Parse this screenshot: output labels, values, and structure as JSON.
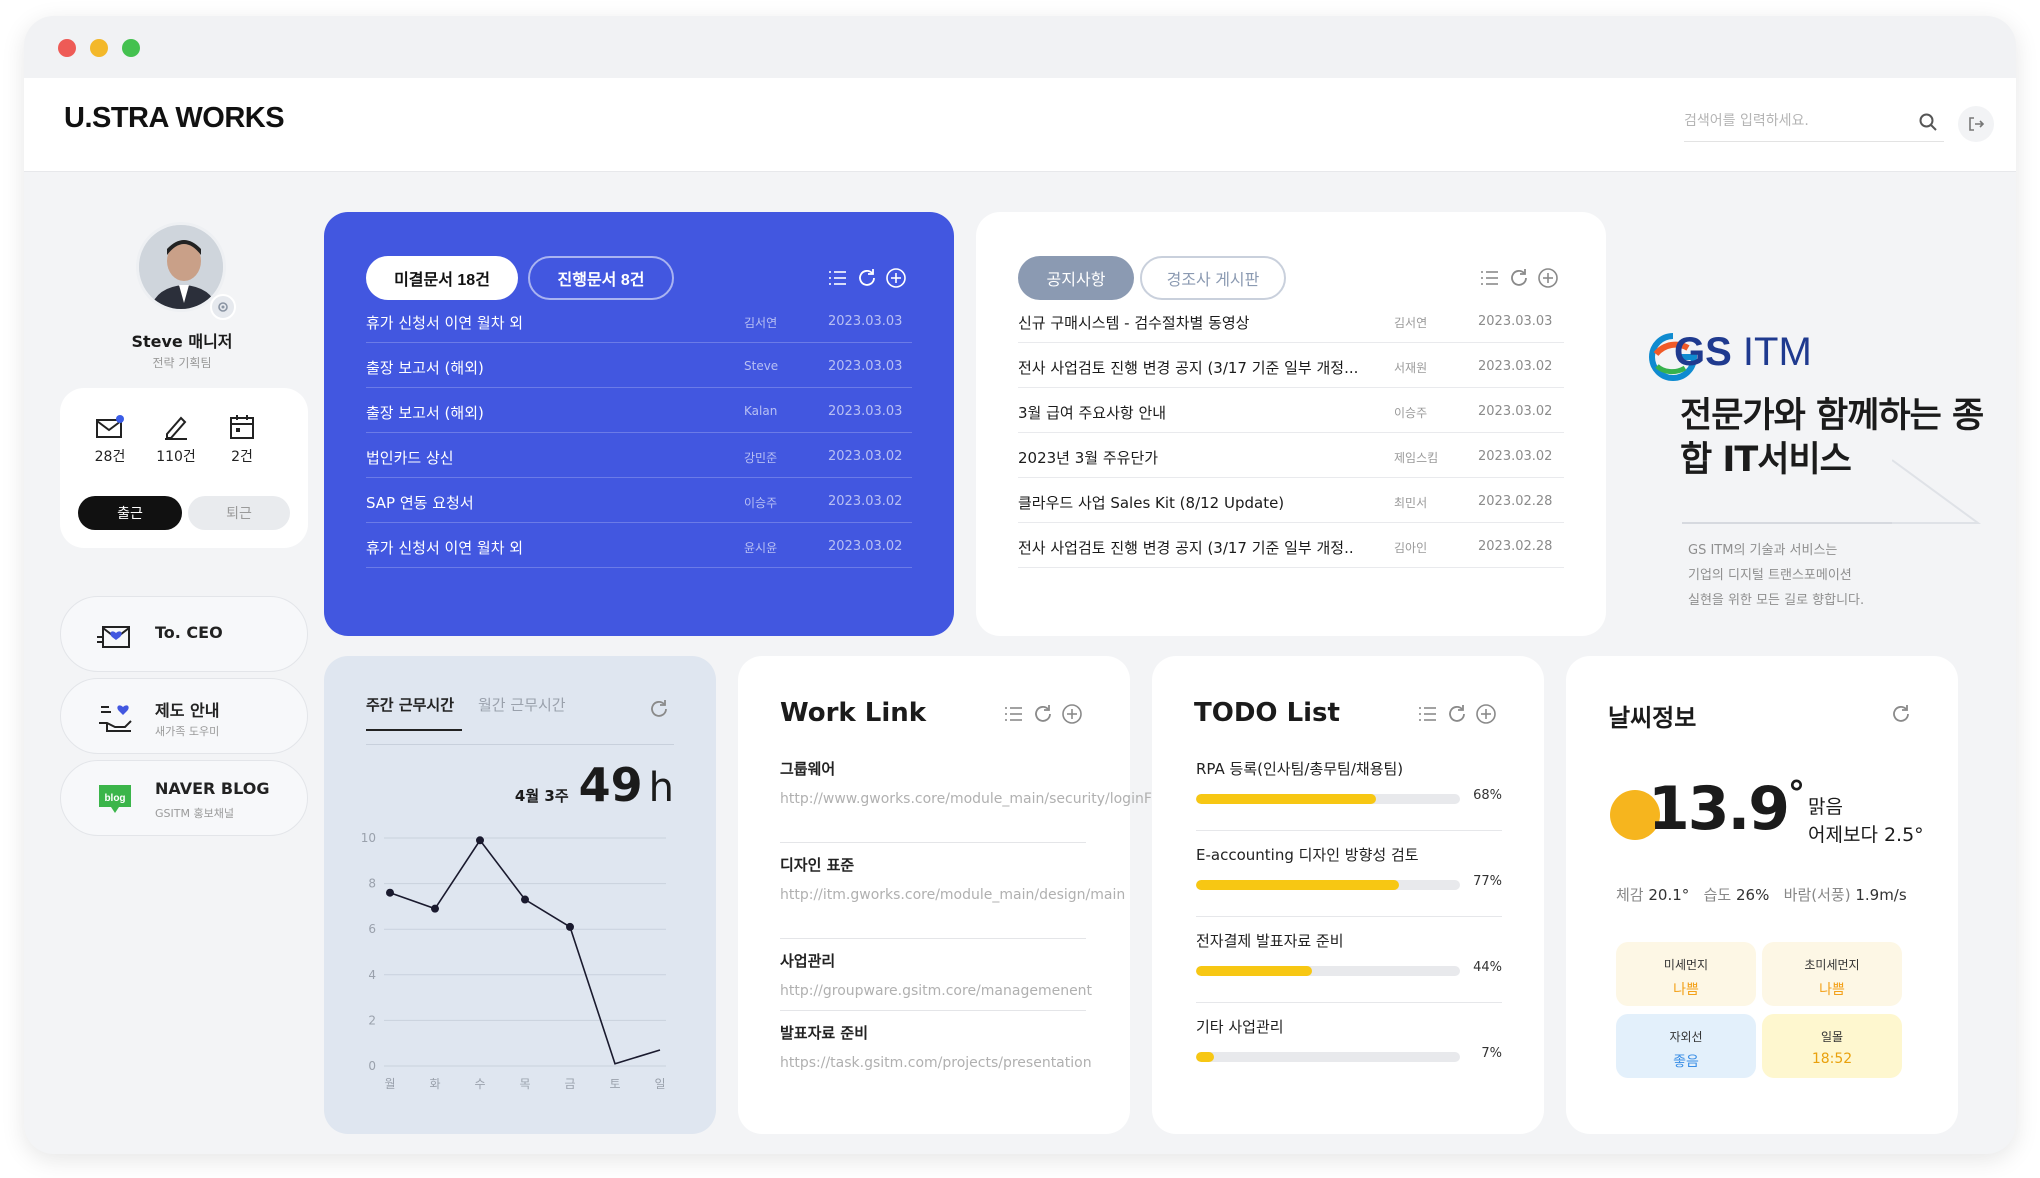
{
  "brand": {
    "logo": "U.STRA WORKS"
  },
  "header": {
    "search_placeholder": "검색어를 입력하세요."
  },
  "user": {
    "name": "Steve 매니저",
    "dept": "전략 기획팀",
    "stats": [
      {
        "icon": "mail-icon",
        "count": "28건"
      },
      {
        "icon": "pen-icon",
        "count": "110건"
      },
      {
        "icon": "calendar-icon",
        "count": "2건"
      }
    ],
    "checkin_label": "출근",
    "checkout_label": "퇴근"
  },
  "side_links": [
    {
      "title": "To. CEO",
      "sub": "",
      "icon": "heart-mail-icon"
    },
    {
      "title": "제도 안내",
      "sub": "새가족 도우미",
      "icon": "hand-heart-icon"
    },
    {
      "title": "NAVER BLOG",
      "sub": "GSITM 홍보채널",
      "icon": "blog-icon"
    }
  ],
  "approval": {
    "tabs": [
      "미결문서 18건",
      "진행문서 8건"
    ],
    "rows": [
      {
        "title": "휴가 신청서 이연 월차 외",
        "author": "김서연",
        "date": "2023.03.03"
      },
      {
        "title": "출장 보고서 (해외)",
        "author": "Steve",
        "date": "2023.03.03"
      },
      {
        "title": "출장 보고서 (해외)",
        "author": "Kalan",
        "date": "2023.03.03"
      },
      {
        "title": "법인카드 상신",
        "author": "강민준",
        "date": "2023.03.02"
      },
      {
        "title": "SAP 연동 요청서",
        "author": "이승주",
        "date": "2023.03.02"
      },
      {
        "title": "휴가 신청서 이연 월차 외",
        "author": "윤시윤",
        "date": "2023.03.02"
      }
    ]
  },
  "notice": {
    "tabs": [
      "공지사항",
      "경조사 게시판"
    ],
    "rows": [
      {
        "title": "신규 구매시스템 - 검수절차별 동영상",
        "author": "김서연",
        "date": "2023.03.03"
      },
      {
        "title": "전사 사업검토 진행 변경 공지 (3/17 기준 일부 개정...",
        "author": "서재원",
        "date": "2023.03.02"
      },
      {
        "title": "3월 급여 주요사항 안내",
        "author": "이승주",
        "date": "2023.03.02"
      },
      {
        "title": "2023년 3월 주유단가",
        "author": "제임스킴",
        "date": "2023.03.02"
      },
      {
        "title": "클라우드 사업 Sales Kit (8/12 Update)",
        "author": "최민서",
        "date": "2023.02.28"
      },
      {
        "title": "전사 사업검토 진행 변경 공지 (3/17 기준 일부 개정..",
        "author": "김아인",
        "date": "2023.02.28"
      }
    ]
  },
  "ad": {
    "logo_gs": "GS",
    "logo_itm": "ITM",
    "headline": "전문가와 함께하는 종합 IT서비스",
    "text_lines": [
      "GS ITM의 기술과 서비스는",
      "기업의 디지털 트랜스포메이션",
      "실현을 위한 모든 길로 향합니다."
    ]
  },
  "worktime": {
    "tabs": [
      "주간 근무시간",
      "월간 근무시간"
    ],
    "week_label": "4월 3주",
    "hours": "49",
    "unit": "h"
  },
  "chart_data": {
    "type": "line",
    "categories": [
      "월",
      "화",
      "수",
      "목",
      "금",
      "토",
      "일"
    ],
    "values": [
      7.6,
      6.9,
      9.9,
      7.3,
      6.1,
      0.1,
      0.7
    ],
    "ylim": [
      0,
      10
    ],
    "yticks": [
      "0",
      "2",
      "4",
      "6",
      "8",
      "10"
    ],
    "grid": true
  },
  "worklink": {
    "title": "Work Link",
    "items": [
      {
        "title": "그룹웨어",
        "url": "http://www.gworks.core/module_main/security/loginForm"
      },
      {
        "title": "디자인 표준",
        "url": "http://itm.gworks.core/module_main/design/main"
      },
      {
        "title": "사업관리",
        "url": "http://groupware.gsitm.core/managemenent"
      },
      {
        "title": "발표자료 준비",
        "url": "https://task.gsitm.com/projects/presentation"
      }
    ]
  },
  "todo": {
    "title": "TODO List",
    "items": [
      {
        "title": "RPA 등록(인사팀/총무팀/채용팀)",
        "percent": 68,
        "label": "68%"
      },
      {
        "title": "E-accounting 디자인 방향성 검토",
        "percent": 77,
        "label": "77%"
      },
      {
        "title": "전자결제 발표자료 준비",
        "percent": 44,
        "label": "44%"
      },
      {
        "title": "기타 사업관리",
        "percent": 7,
        "label": "7%"
      }
    ]
  },
  "weather": {
    "title": "날씨정보",
    "temp": "13.9",
    "deg": "°",
    "condition": "맑음",
    "compare": "어제보다 2.5°",
    "feels_label": "체감",
    "feels": "20.1°",
    "humidity_label": "습도",
    "humidity": "26%",
    "wind_label": "바람(서풍)",
    "wind": "1.9m/s",
    "air": [
      {
        "label": "미세먼지",
        "value": "나쁨",
        "bg": "#fdf7e5",
        "color": "#f3a11a"
      },
      {
        "label": "초미세먼지",
        "value": "나쁨",
        "bg": "#fdf7e5",
        "color": "#f3a11a"
      },
      {
        "label": "자외선",
        "value": "좋음",
        "bg": "#e3f0fb",
        "color": "#3a8ee6"
      },
      {
        "label": "일몰",
        "value": "18:52",
        "bg": "#fef7cf",
        "color": "#e9a10c"
      }
    ]
  },
  "colors": {
    "primary": "#4257e0",
    "accent": "#f7c713",
    "sun": "#f6b51e"
  }
}
